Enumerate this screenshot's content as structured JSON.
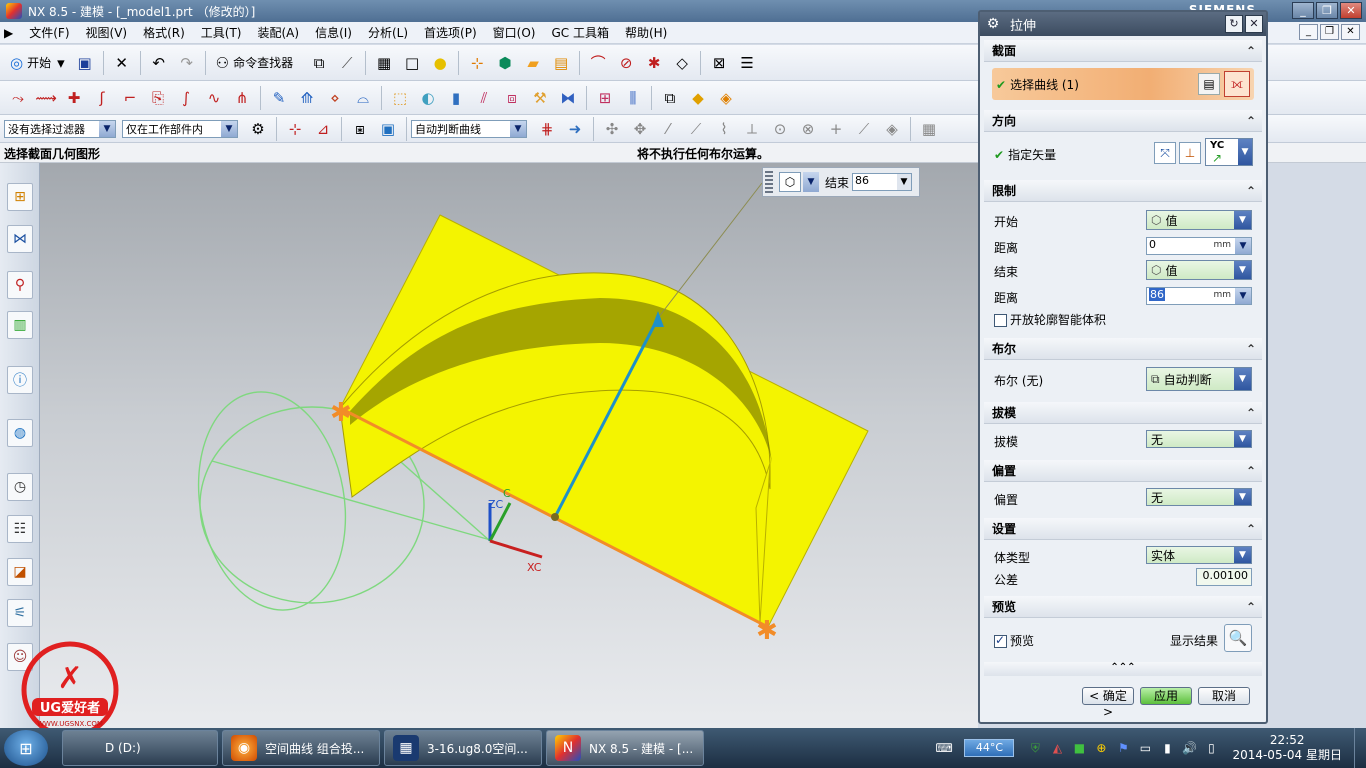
{
  "window": {
    "title": "NX 8.5 - 建模 - [_model1.prt （修改的）]",
    "brand": "SIEMENS",
    "buttons": [
      "minimize",
      "restore",
      "close"
    ]
  },
  "menu": {
    "items": [
      "文件(F)",
      "视图(V)",
      "格式(R)",
      "工具(T)",
      "装配(A)",
      "信息(I)",
      "分析(L)",
      "首选项(P)",
      "窗口(O)",
      "GC 工具箱",
      "帮助(H)"
    ]
  },
  "toolbar": {
    "start_label": "开始",
    "command_finder_label": "命令查找器"
  },
  "selection_bar": {
    "filter": "没有选择过滤器",
    "scope": "仅在工作部件内",
    "curve_rule": "自动判断曲线"
  },
  "cue_line": {
    "cue": "选择截面几何图形",
    "status": "将不执行任何布尔运算。"
  },
  "onscreen_input": {
    "label": "结束",
    "value": "86"
  },
  "graphics": {
    "axis_labels": {
      "zc": "ZC",
      "xc": "XC",
      "yc": "C"
    },
    "face_color": "#f4f400",
    "edge_color": "#f28c28",
    "vector_color": "#1e90c8",
    "curve_color": "#7fd87f"
  },
  "dialog": {
    "title": "拉伸",
    "sections": {
      "section": {
        "header": "截面",
        "select_curve": "选择曲线 (1)"
      },
      "direction": {
        "header": "方向",
        "specify_vector": "指定矢量",
        "vector_option": "YC"
      },
      "limits": {
        "header": "限制",
        "start_label": "开始",
        "start_option": "值",
        "start_distance_label": "距离",
        "start_distance": "0",
        "end_label": "结束",
        "end_option": "值",
        "end_distance_label": "距离",
        "end_distance": "86",
        "unit": "mm",
        "open_profile": "开放轮廓智能体积"
      },
      "boolean": {
        "header": "布尔",
        "label": "布尔 (无)",
        "option": "自动判断"
      },
      "draft": {
        "header": "拔模",
        "label": "拔模",
        "option": "无"
      },
      "offset": {
        "header": "偏置",
        "label": "偏置",
        "option": "无"
      },
      "settings": {
        "header": "设置",
        "body_type_label": "体类型",
        "body_type": "实体",
        "tolerance_label": "公差",
        "tolerance": "0.00100"
      },
      "preview": {
        "header": "预览",
        "preview_label": "预览",
        "show_result": "显示结果"
      }
    },
    "buttons": {
      "ok": "< 确定 >",
      "apply": "应用",
      "cancel": "取消"
    }
  },
  "taskbar": {
    "tasks": [
      {
        "label": "D (D:)"
      },
      {
        "label": "空间曲线 组合投..."
      },
      {
        "label": "3-16.ug8.0空间..."
      },
      {
        "label": "NX 8.5 - 建模 - [..."
      }
    ],
    "temperature": "44°C",
    "time": "22:52",
    "date": "2014-05-04 星期日"
  },
  "watermark": {
    "text": "UG爱好者",
    "url": "WWW.UGSNX.COM"
  }
}
